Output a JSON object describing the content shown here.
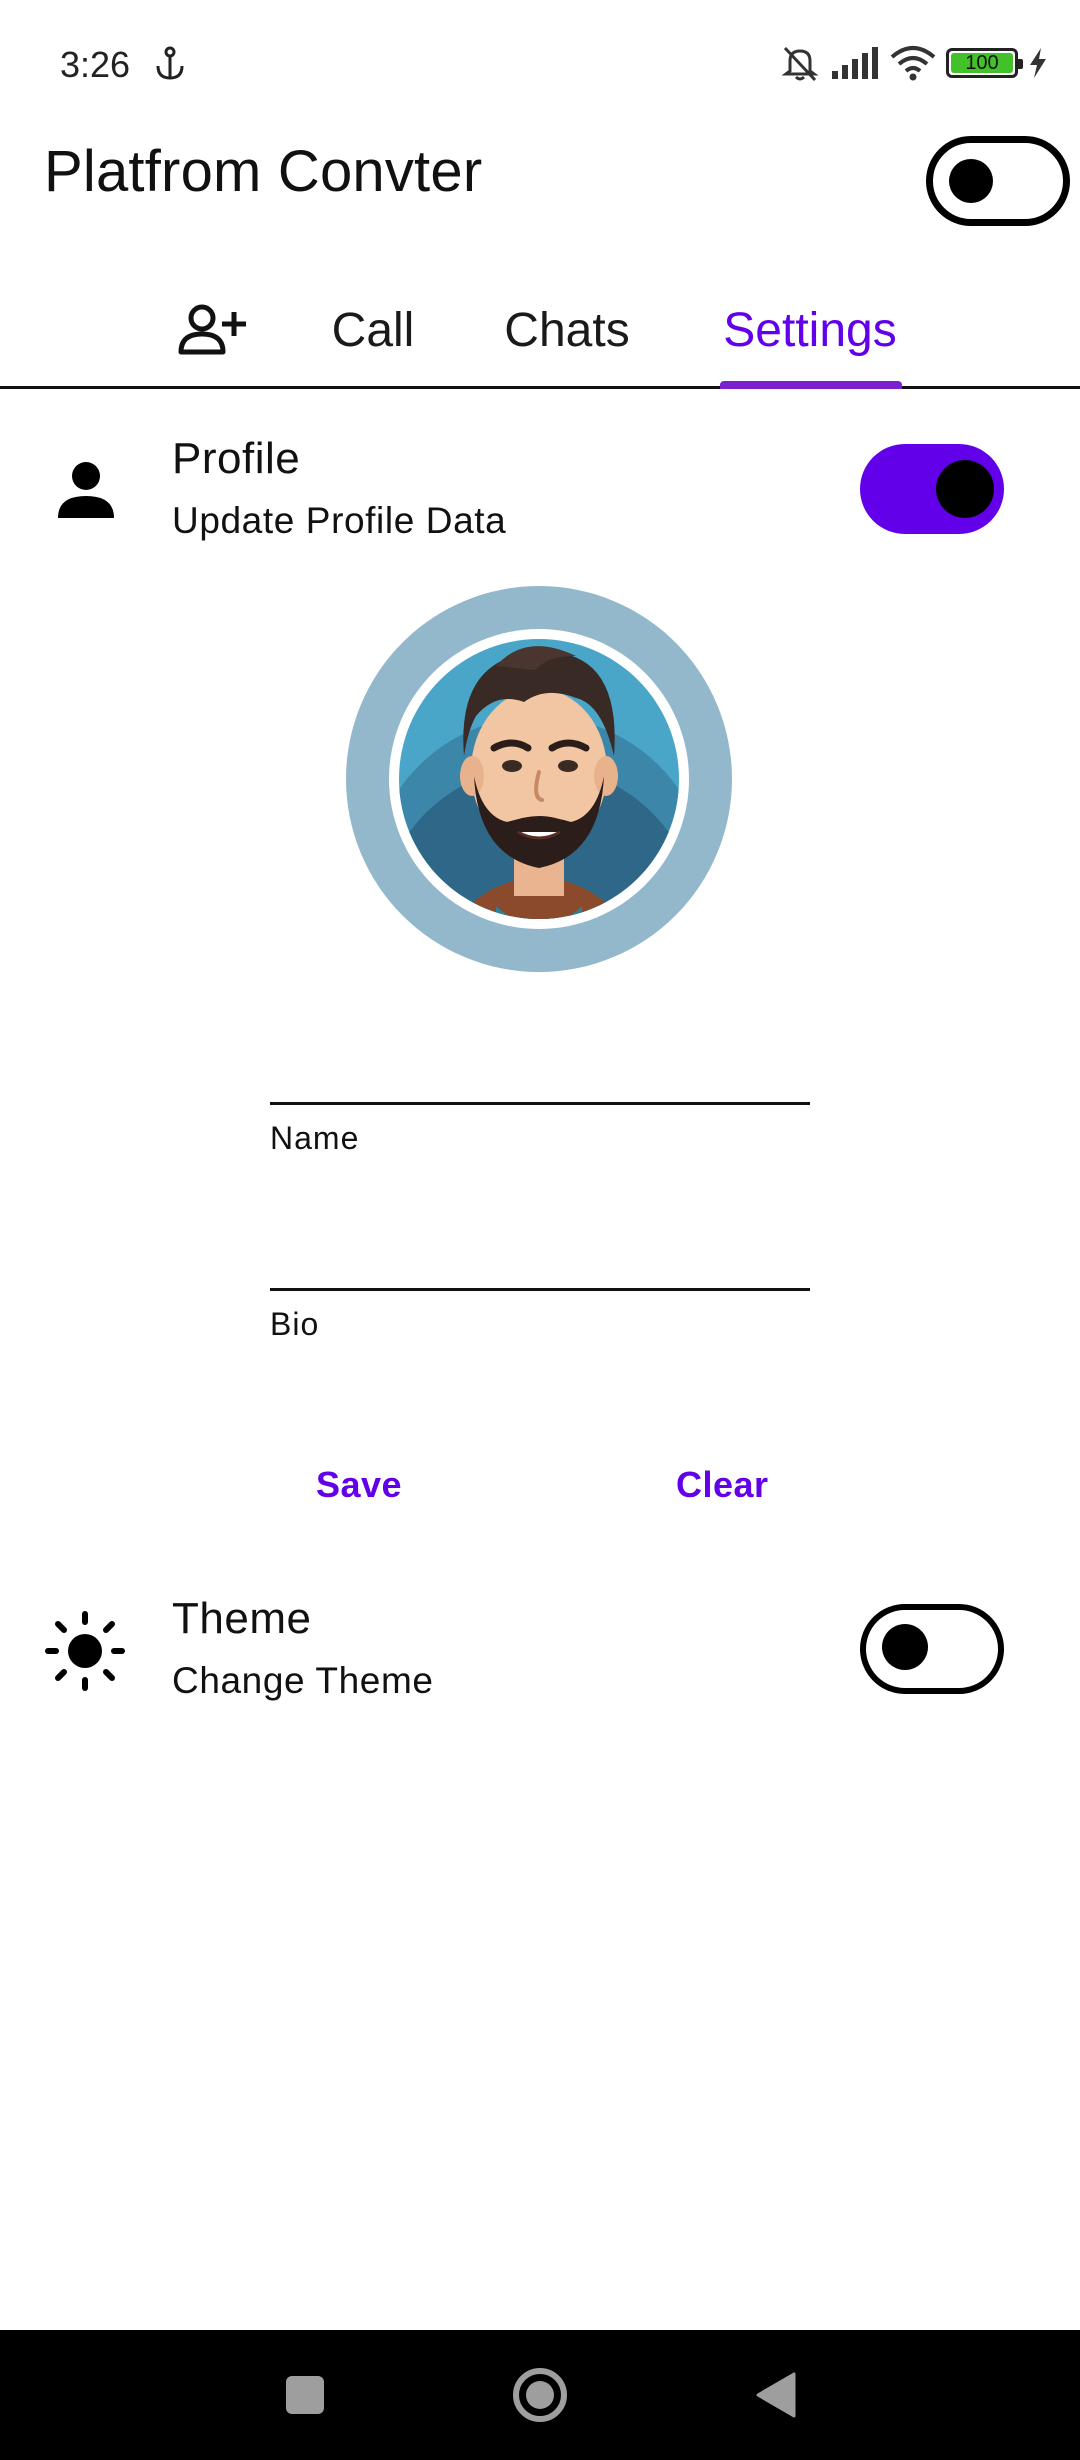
{
  "status_bar": {
    "time": "3:26",
    "battery_level": "100",
    "icons": [
      "anchor-icon",
      "bell-off-icon",
      "signal-icon",
      "wifi-icon",
      "battery-icon",
      "charging-icon"
    ]
  },
  "app_bar": {
    "title": "Platfrom Convter",
    "toggle_on": false
  },
  "tabs": {
    "add_icon": "person-add-icon",
    "items": [
      {
        "label": "Call"
      },
      {
        "label": "Chats"
      },
      {
        "label": "Settings",
        "selected": true
      }
    ],
    "selected_color": "#6200ea"
  },
  "profile": {
    "icon": "person-icon",
    "title": "Profile",
    "subtitle": "Update Profile Data",
    "toggle_on": true,
    "toggle_color": "#6200ea"
  },
  "form": {
    "name_label": "Name",
    "name_value": "",
    "bio_label": "Bio",
    "bio_value": "",
    "save_label": "Save",
    "clear_label": "Clear",
    "accent": "#6200ea"
  },
  "theme": {
    "icon": "sun-icon",
    "title": "Theme",
    "subtitle": "Change Theme",
    "toggle_on": false
  },
  "nav_bar": {
    "buttons": [
      "recents-icon",
      "home-icon",
      "back-icon"
    ]
  }
}
